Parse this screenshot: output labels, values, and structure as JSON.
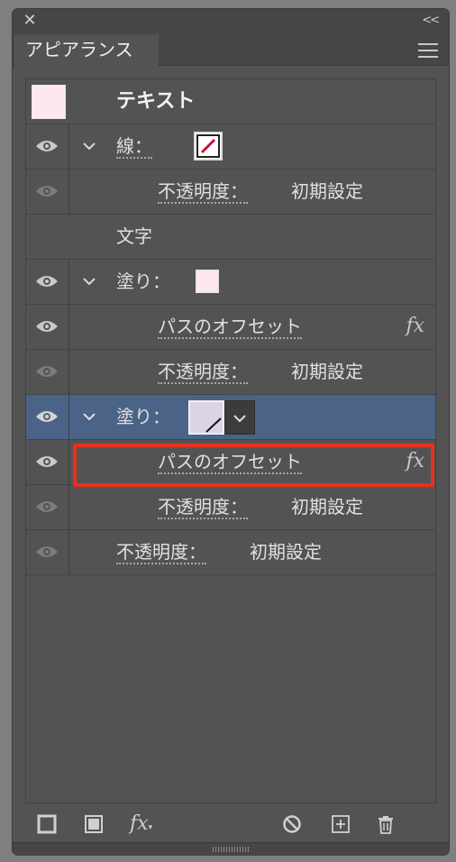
{
  "panel": {
    "close_icon": "close-icon",
    "collapse_label": "<<",
    "tab_label": "アピアランス",
    "menu_icon": "hamburger-menu-icon"
  },
  "header_row": {
    "label": "テキスト",
    "swatch_color": "#fde8ee"
  },
  "rows": {
    "stroke": {
      "label": "線："
    },
    "stroke_opacity": {
      "label": "不透明度：",
      "value": "初期設定"
    },
    "characters": {
      "label": "文字"
    },
    "fill1": {
      "label": "塗り：",
      "swatch_color": "#fde8ee"
    },
    "fill1_offset": {
      "label": "パスのオフセット",
      "fx": "fx"
    },
    "fill1_opacity": {
      "label": "不透明度：",
      "value": "初期設定"
    },
    "fill2": {
      "label": "塗り：",
      "swatch_color": "#ddd3e6"
    },
    "fill2_offset": {
      "label": "パスのオフセット",
      "fx": "fx"
    },
    "fill2_opacity": {
      "label": "不透明度：",
      "value": "初期設定"
    },
    "object_opacity": {
      "label": "不透明度：",
      "value": "初期設定"
    }
  },
  "bottom_toolbar": {
    "fx_label": "fx"
  },
  "colors": {
    "panel_bg": "#535353",
    "selected_row": "#4b6386",
    "highlight_border": "#e8301c",
    "stroke_red": "#c8102e"
  }
}
